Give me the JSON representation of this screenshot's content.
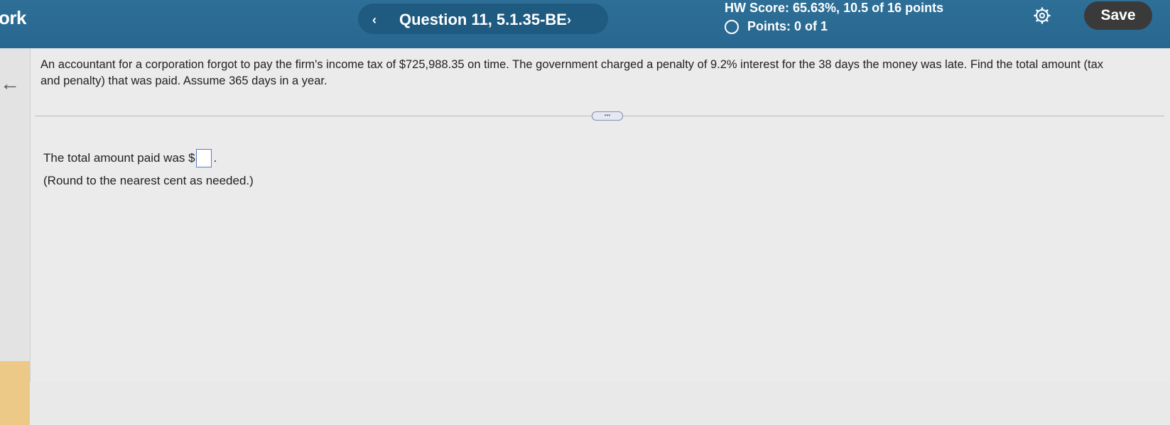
{
  "header": {
    "app_title": "ork",
    "question_label": "Question 11, 5.1.35-BE",
    "prev_icon": "chevron-left-icon",
    "next_icon": "chevron-right-icon",
    "hw_score": "HW Score: 65.63%, 10.5 of 16 points",
    "points": "Points: 0 of 1",
    "settings_icon": "gear-icon",
    "save_label": "Save"
  },
  "question": {
    "text": "An accountant for a corporation forgot to pay the firm's income tax of $725,988.35 on time. The government charged a penalty of 9.2% interest for the 38 days the money was late. Find the total amount (tax and penalty) that was paid. Assume 365 days in a year.",
    "answer_prefix": "The total amount paid was $",
    "answer_value": "",
    "answer_suffix": ".",
    "round_note": "(Round to the nearest cent as needed.)"
  },
  "colors": {
    "header_bg": "#2b6b93",
    "save_bg": "#3a3a3a",
    "gutter_tab": "#ecc987"
  }
}
